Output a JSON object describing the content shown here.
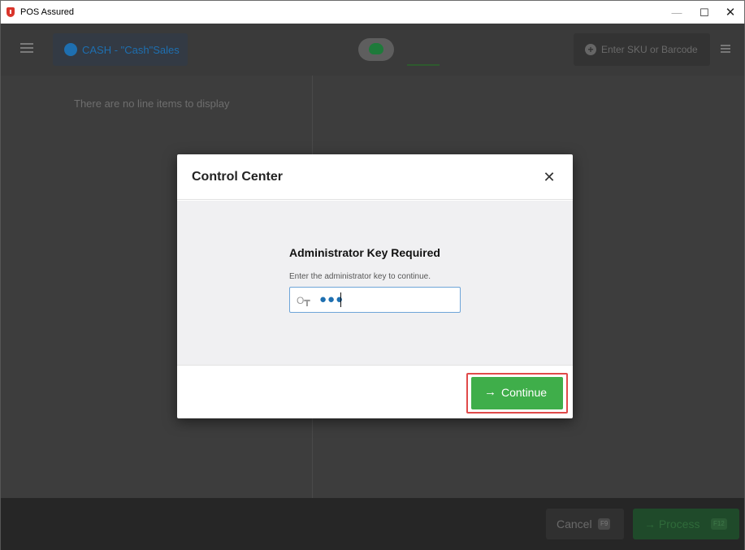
{
  "window": {
    "title": "POS Assured",
    "minimize": "—",
    "maximize": "☐",
    "close": "✕"
  },
  "header": {
    "customer": "CASH - \"Cash\"Sales",
    "sku_placeholder": "Enter SKU or Barcode"
  },
  "line_items": {
    "empty_message": "There are no line items to display"
  },
  "footer": {
    "cancel_label": "Cancel",
    "cancel_key": "F9",
    "process_label": "→ Process",
    "process_key": "F12"
  },
  "modal": {
    "title": "Control Center",
    "close": "✕",
    "auth_title": "Administrator Key Required",
    "auth_subtitle": "Enter the administrator key to continue.",
    "key_value_masked": "●●●",
    "continue_label": "Continue",
    "continue_arrow": "→"
  },
  "colors": {
    "accent_blue": "#1e6fb0",
    "continue_green": "#3fae4a",
    "highlight_red": "#e04a4a"
  }
}
